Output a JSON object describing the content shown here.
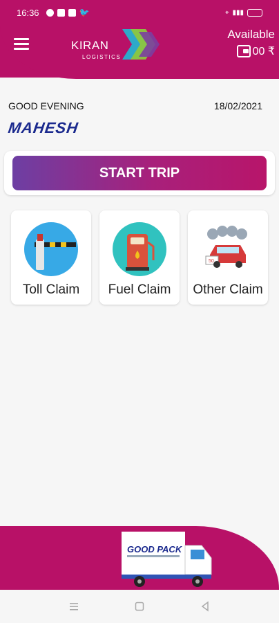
{
  "status_bar": {
    "time": "16:36"
  },
  "header": {
    "brand": "KIRAN",
    "brand_sub": "LOGISTICS",
    "available_label": "Available",
    "balance": "00 ₹"
  },
  "greeting": {
    "text": "GOOD EVENING",
    "date": "18/02/2021",
    "name": "MAHESH"
  },
  "trip": {
    "button_label": "START TRIP"
  },
  "claims": [
    {
      "label": "Toll Claim",
      "icon": "toll-gate-icon"
    },
    {
      "label": "Fuel Claim",
      "icon": "fuel-pump-icon"
    },
    {
      "label": "Other Claim",
      "icon": "car-wash-icon"
    }
  ],
  "footer": {
    "truck_brand": "GOOD PACK"
  },
  "colors": {
    "brand": "#b81167",
    "accent": "#6d3fa3",
    "name": "#1b2a8e"
  }
}
